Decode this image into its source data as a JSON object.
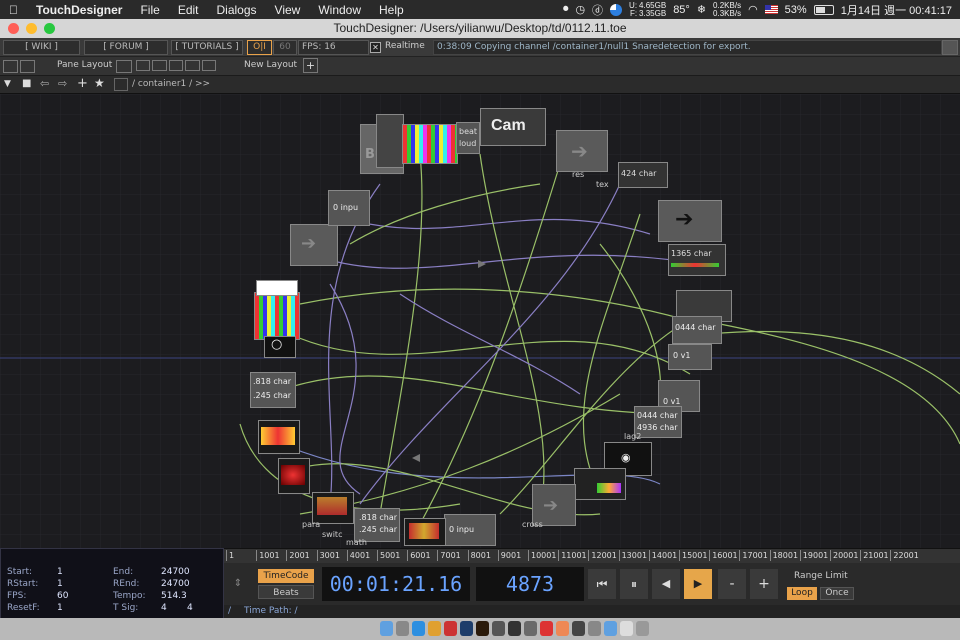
{
  "menubar": {
    "apple": "",
    "app_name": "TouchDesigner",
    "items": [
      "File",
      "Edit",
      "Dialogs",
      "View",
      "Window",
      "Help"
    ],
    "mem": [
      "4.65GB",
      "3.35GB"
    ],
    "mem_labels": [
      "U:",
      "F:"
    ],
    "temp": "85°",
    "net": [
      "0.2KB/s",
      "0.3KB/s"
    ],
    "battery": "53%",
    "clock": "1月14日 週一  00:41:17"
  },
  "window": {
    "title": "TouchDesigner: /Users/yilianwu/Desktop/td/0112.11.toe"
  },
  "toolbar": {
    "wiki": "[ WIKI ]",
    "forum": "[ FORUM ]",
    "tutorials": "[ TUTORIALS ]",
    "oi": "O|I",
    "fps_value": "60",
    "fps_label": "FPS:  16",
    "realtime": "Realtime",
    "status": "0:38:09 Copying channel /container1/null1 Snaredetection for export."
  },
  "toolbar2": {
    "pane_layout": "Pane Layout",
    "new_layout": "New Layout",
    "plus": "+"
  },
  "pathbar": {
    "path": "/ container1 / >>"
  },
  "network": {
    "nodes": [
      {
        "label": "Cam"
      },
      {
        "label": "Bu"
      },
      {
        "label": "beat"
      },
      {
        "label": "loud"
      },
      {
        "label": "0 inpu"
      },
      {
        "label": "424 char"
      },
      {
        "label": "1365 char"
      },
      {
        "label": "0444 char"
      },
      {
        "label": "0 v1"
      },
      {
        "label": "0 v1"
      },
      {
        "label": "0444 char"
      },
      {
        "label": "4936 char"
      },
      {
        "label": ".818 char"
      },
      {
        "label": ".245 char"
      },
      {
        "label": ".818 char"
      },
      {
        "label": ".245 char"
      },
      {
        "label": "0 inpu"
      },
      {
        "label": "lag2"
      },
      {
        "label": "cross"
      },
      {
        "label": "para"
      },
      {
        "label": "math"
      },
      {
        "label": "switc"
      },
      {
        "label": "res"
      },
      {
        "label": "tex"
      }
    ]
  },
  "timeline": {
    "ticks": [
      "1",
      "1001",
      "2001",
      "3001",
      "4001",
      "5001",
      "6001",
      "7001",
      "8001",
      "9001",
      "10001",
      "11001",
      "12001",
      "13001",
      "14001",
      "15001",
      "16001",
      "17001",
      "18001",
      "19001",
      "20001",
      "21001",
      "22001"
    ]
  },
  "info": {
    "start_label": "Start:",
    "start": "1",
    "end_label": "End:",
    "end": "24700",
    "rstart_label": "RStart:",
    "rstart": "1",
    "rend_label": "REnd:",
    "rend": "24700",
    "fps_label": "FPS:",
    "fps": "60",
    "tempo_label": "Tempo:",
    "tempo": "514.3",
    "resetf_label": "ResetF:",
    "resetf": "1",
    "tsig_label": "T Sig:",
    "tsig1": "4",
    "tsig2": "4"
  },
  "transport": {
    "timecode": "TimeCode",
    "beats": "Beats",
    "time": "00:01:21.16",
    "frame": "4873",
    "btn_start": "⏮",
    "btn_pause": "⏸",
    "btn_back": "◀",
    "btn_play": "▶",
    "btn_minus": "-",
    "btn_plus": "+",
    "range_limit": "Range Limit",
    "loop": "Loop",
    "once": "Once"
  },
  "timepath": {
    "label": "Time Path: /",
    "slash": "/"
  },
  "colors": {
    "accent_orange": "#e9a24a",
    "play_orange": "#e6a64a",
    "time_blue": "#6aa3ff"
  }
}
